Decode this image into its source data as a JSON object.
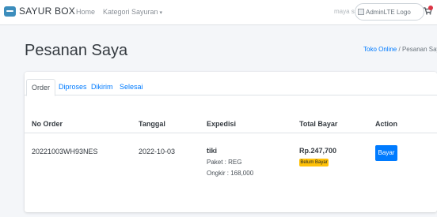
{
  "navbar": {
    "brand": "SAYUR BOX",
    "home": "Home",
    "kategori": "Kategori Sayuran",
    "user_name": "maya sari",
    "user_image_alt": "AdminLTE Logo",
    "cart_icon": "cart-icon"
  },
  "header": {
    "title": "Pesanan Saya",
    "breadcrumb": {
      "link": "Toko Online",
      "separator": "/",
      "active": "Pesanan Saya"
    }
  },
  "tabs": [
    {
      "label": "Order",
      "active": true
    },
    {
      "label": "Diproses",
      "active": false
    },
    {
      "label": "Dikirim",
      "active": false
    },
    {
      "label": "Selesai",
      "active": false
    }
  ],
  "table": {
    "columns": [
      "No Order",
      "Tanggal",
      "Expedisi",
      "Total Bayar",
      "Action"
    ],
    "rows": [
      {
        "no_order": "20221003WH93NES",
        "tanggal": "2022-10-03",
        "expedisi": "tiki",
        "paket": "Paket : REG",
        "ongkir": "Ongkir : 168,000",
        "total": "Rp.247,700",
        "status": "Belum Bayar",
        "action": "Bayar"
      }
    ]
  },
  "colors": {
    "primary": "#007bff",
    "warning": "#ffc107",
    "danger": "#dc3545",
    "background": "#f4f6f9"
  }
}
